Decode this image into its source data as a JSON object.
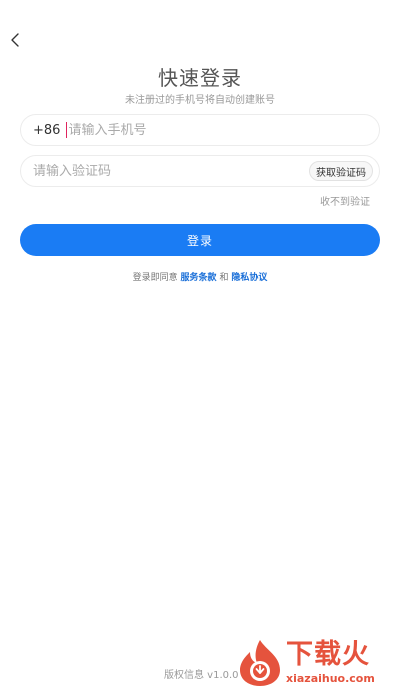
{
  "header": {
    "back_icon": "chevron-left-icon"
  },
  "title": "快速登录",
  "subtitle": "未注册过的手机号将自动创建账号",
  "phone": {
    "country_code": "+86",
    "placeholder": "请输入手机号",
    "value": ""
  },
  "code": {
    "placeholder": "请输入验证码",
    "value": "",
    "get_code_label": "获取验证码"
  },
  "no_code_label": "收不到验证",
  "login_label": "登录",
  "agreement": {
    "prefix": "登录即同意",
    "terms": "服务条款",
    "and": "和",
    "privacy": "隐私协议"
  },
  "version": "版权信息 v1.0.0",
  "watermark": {
    "text": "下载火",
    "sub": "xiazaihuo.com",
    "icon": "flame-logo-icon"
  },
  "colors": {
    "accent": "#1a7cf4",
    "link": "#1a6fd8",
    "caret": "#e0245e",
    "watermark": "#e5533d"
  }
}
